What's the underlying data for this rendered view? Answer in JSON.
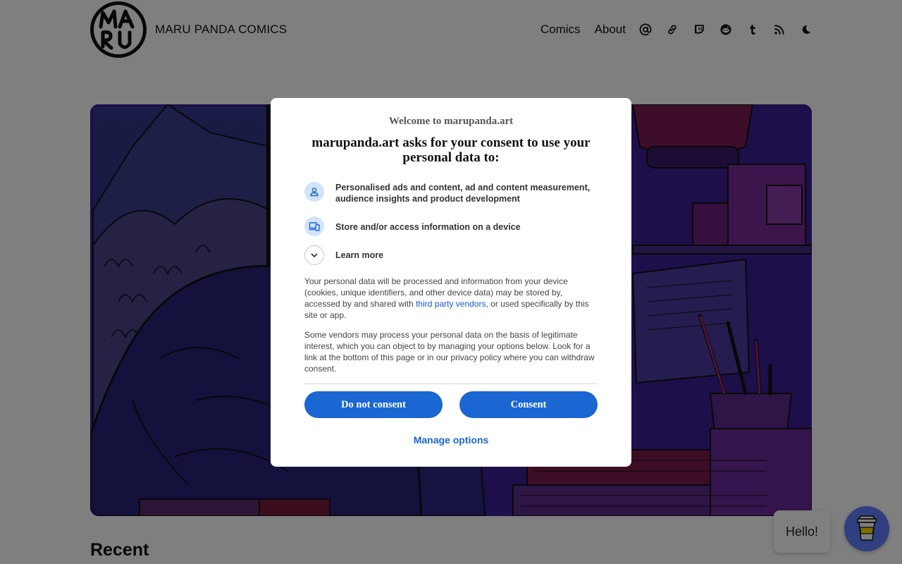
{
  "site": {
    "logo_text": "MARU",
    "title": "MARU PANDA COMICS"
  },
  "nav": {
    "links": [
      "Comics",
      "About"
    ],
    "icons": [
      "mastodon-icon",
      "link-icon",
      "twitch-icon",
      "reddit-icon",
      "tumblr-icon",
      "rss-icon",
      "dark-mode-moon-icon"
    ]
  },
  "main": {
    "recent_heading": "Recent"
  },
  "widgets": {
    "hello_text": "Hello!",
    "coffee_icon": "coffee-cup-icon",
    "coffee_color": "#5f7fff"
  },
  "consent": {
    "welcome": "Welcome to marupanda.art",
    "heading": "marupanda.art asks for your consent to use your personal data to:",
    "purposes": [
      {
        "icon": "person-icon",
        "text": "Personalised ads and content, ad and content measurement, audience insights and product development"
      },
      {
        "icon": "devices-icon",
        "text": "Store and/or access information on a device"
      }
    ],
    "learn_more": "Learn more",
    "para1_before": "Your personal data will be processed and information from your device (cookies, unique identifiers, and other device data) may be stored by, accessed by and shared with ",
    "para1_link": "third party vendors",
    "para1_after": ", or used specifically by this site or app.",
    "para2": "Some vendors may process your personal data on the basis of legitimate interest, which you can object to by managing your options below. Look for a link at the bottom of this page or in our privacy policy where you can withdraw consent.",
    "do_not_consent": "Do not consent",
    "consent": "Consent",
    "manage_options": "Manage options",
    "accent_color": "#1a66d2"
  }
}
